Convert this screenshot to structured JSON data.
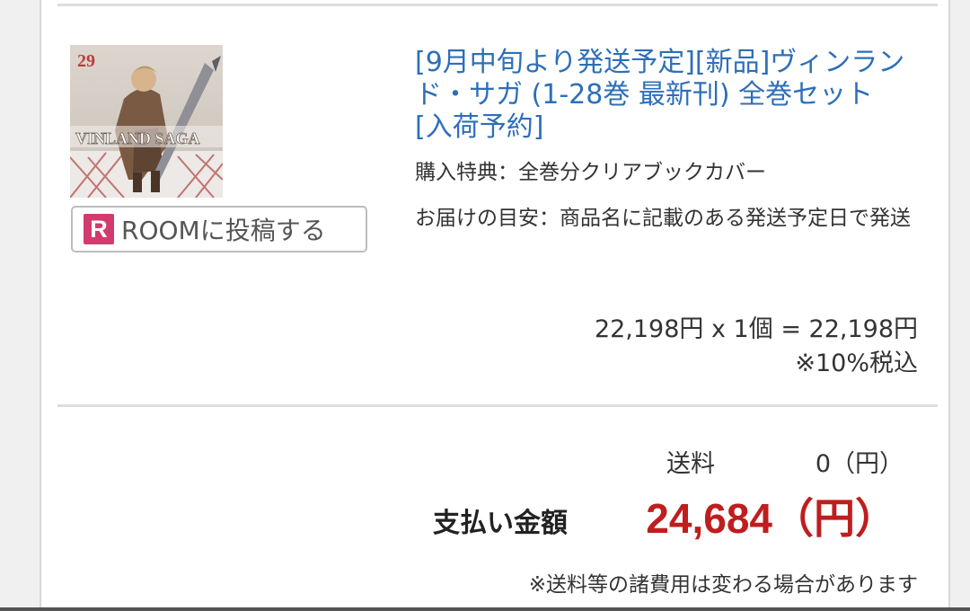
{
  "item": {
    "cover": {
      "volume_number": "29",
      "series_logo_text": "VINLAND SAGA"
    },
    "room_button": {
      "logo_letter": "R",
      "label": "ROOMに投稿する"
    },
    "title": "[9月中旬より発送予定][新品]ヴィンランド・サガ (1-28巻 最新刊) 全巻セット [入荷予約]",
    "bonus": "購入特典：全巻分クリアブックカバー",
    "delivery": "お届けの目安：商品名に記載のある発送予定日で発送",
    "price_line": "22,198円 x 1個 = 22,198円",
    "tax_note": "※10%税込"
  },
  "summary": {
    "shipping_label": "送料",
    "shipping_value": "0（円）",
    "total_label": "支払い金額",
    "total_value": "24,684（円）",
    "note": "※送料等の諸費用は変わる場合があります"
  },
  "colors": {
    "link": "#2d6fb9",
    "total": "#bf1e1e",
    "room_logo": "#d33b6f"
  }
}
